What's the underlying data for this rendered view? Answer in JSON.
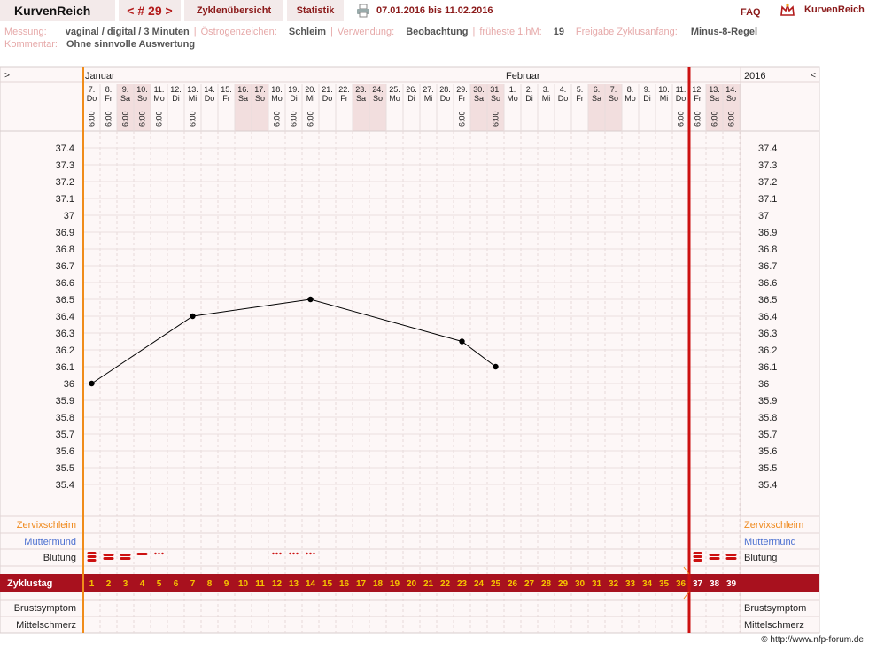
{
  "header": {
    "brand": "KurvenReich",
    "cycle_nav": "< # 29 >",
    "overview": "Zyklenübersicht",
    "stats": "Statistik",
    "date_range": "07.01.2016 bis 11.02.2016",
    "faq": "FAQ",
    "logo_text": "KurvenReich"
  },
  "info": {
    "messung_label": "Messung:",
    "messung_value": "vaginal / digital / 3 Minuten",
    "oestrogen_label": "Östrogenzeichen:",
    "oestrogen_value": "Schleim",
    "verwendung_label": "Verwendung:",
    "verwendung_value": "Beobachtung",
    "fruehe_label": "früheste 1.hM:",
    "fruehe_value": "19",
    "freigabe_label": "Freigabe Zyklusanfang:",
    "freigabe_value": "Minus-8-Regel",
    "kommentar_label": "Kommentar:",
    "kommentar_value": "Ohne sinnvolle Auswertung"
  },
  "nav": {
    "left_arrow": ">",
    "right_arrow": "<",
    "year": "2016"
  },
  "chart_data": {
    "type": "line",
    "months": [
      {
        "label": "Januar",
        "start_index": 0
      },
      {
        "label": "Februar",
        "start_index": 25
      }
    ],
    "days": [
      {
        "d": "7.",
        "w": "Do",
        "t": "6:00",
        "we": false
      },
      {
        "d": "8.",
        "w": "Fr",
        "t": "6:00",
        "we": false
      },
      {
        "d": "9.",
        "w": "Sa",
        "t": "6:00",
        "we": true
      },
      {
        "d": "10.",
        "w": "So",
        "t": "6:00",
        "we": true
      },
      {
        "d": "11.",
        "w": "Mo",
        "t": "6:00",
        "we": false
      },
      {
        "d": "12.",
        "w": "Di",
        "t": "",
        "we": false
      },
      {
        "d": "13.",
        "w": "Mi",
        "t": "6:00",
        "we": false
      },
      {
        "d": "14.",
        "w": "Do",
        "t": "",
        "we": false
      },
      {
        "d": "15.",
        "w": "Fr",
        "t": "",
        "we": false
      },
      {
        "d": "16.",
        "w": "Sa",
        "t": "",
        "we": true
      },
      {
        "d": "17.",
        "w": "So",
        "t": "",
        "we": true
      },
      {
        "d": "18.",
        "w": "Mo",
        "t": "6:00",
        "we": false
      },
      {
        "d": "19.",
        "w": "Di",
        "t": "6:00",
        "we": false
      },
      {
        "d": "20.",
        "w": "Mi",
        "t": "6:00",
        "we": false
      },
      {
        "d": "21.",
        "w": "Do",
        "t": "",
        "we": false
      },
      {
        "d": "22.",
        "w": "Fr",
        "t": "",
        "we": false
      },
      {
        "d": "23.",
        "w": "Sa",
        "t": "",
        "we": true
      },
      {
        "d": "24.",
        "w": "So",
        "t": "",
        "we": true
      },
      {
        "d": "25.",
        "w": "Mo",
        "t": "",
        "we": false
      },
      {
        "d": "26.",
        "w": "Di",
        "t": "",
        "we": false
      },
      {
        "d": "27.",
        "w": "Mi",
        "t": "",
        "we": false
      },
      {
        "d": "28.",
        "w": "Do",
        "t": "",
        "we": false
      },
      {
        "d": "29.",
        "w": "Fr",
        "t": "6:00",
        "we": false
      },
      {
        "d": "30.",
        "w": "Sa",
        "t": "",
        "we": true
      },
      {
        "d": "31.",
        "w": "So",
        "t": "6:00",
        "we": true
      },
      {
        "d": "1.",
        "w": "Mo",
        "t": "",
        "we": false
      },
      {
        "d": "2.",
        "w": "Di",
        "t": "",
        "we": false
      },
      {
        "d": "3.",
        "w": "Mi",
        "t": "",
        "we": false
      },
      {
        "d": "4.",
        "w": "Do",
        "t": "",
        "we": false
      },
      {
        "d": "5.",
        "w": "Fr",
        "t": "",
        "we": false
      },
      {
        "d": "6.",
        "w": "Sa",
        "t": "",
        "we": true
      },
      {
        "d": "7.",
        "w": "So",
        "t": "",
        "we": true
      },
      {
        "d": "8.",
        "w": "Mo",
        "t": "",
        "we": false
      },
      {
        "d": "9.",
        "w": "Di",
        "t": "",
        "we": false
      },
      {
        "d": "10.",
        "w": "Mi",
        "t": "",
        "we": false
      },
      {
        "d": "11.",
        "w": "Do",
        "t": "6:00",
        "we": false
      },
      {
        "d": "12.",
        "w": "Fr",
        "t": "6:00",
        "we": false
      },
      {
        "d": "13.",
        "w": "Sa",
        "t": "6:00",
        "we": true
      },
      {
        "d": "14.",
        "w": "So",
        "t": "6:00",
        "we": true
      }
    ],
    "y_ticks": [
      "37.4",
      "37.3",
      "37.2",
      "37.1",
      "37",
      "36.9",
      "36.8",
      "36.7",
      "36.6",
      "36.5",
      "36.4",
      "36.3",
      "36.2",
      "36.1",
      "36",
      "35.9",
      "35.8",
      "35.7",
      "35.6",
      "35.5",
      "35.4"
    ],
    "ylim": [
      35.4,
      37.4
    ],
    "series": [
      {
        "points": [
          [
            1,
            36.0
          ],
          [
            7,
            36.4
          ],
          [
            14,
            36.5
          ],
          [
            23,
            36.25
          ],
          [
            25,
            36.1
          ]
        ]
      }
    ],
    "cycle_day_label": "Zyklustag",
    "cycle_day_count": 39,
    "current_cycle_days": 36,
    "rows": {
      "zervix": "Zervixschleim",
      "muttermund": "Muttermund",
      "blutung": "Blutung",
      "brust": "Brustsymptom",
      "mittel": "Mittelschmerz"
    },
    "bleeding": [
      {
        "day": 1,
        "level": "stark"
      },
      {
        "day": 2,
        "level": "mittel"
      },
      {
        "day": 3,
        "level": "mittel"
      },
      {
        "day": 4,
        "level": "schwach"
      },
      {
        "day": 5,
        "level": "schmier"
      },
      {
        "day": 12,
        "level": "schmier"
      },
      {
        "day": 13,
        "level": "schmier"
      },
      {
        "day": 14,
        "level": "schmier"
      },
      {
        "day": 37,
        "level": "stark"
      },
      {
        "day": 38,
        "level": "mittel"
      },
      {
        "day": 39,
        "level": "mittel"
      }
    ],
    "colors": {
      "band": "#a8111e",
      "current_line": "#cc1111",
      "cycle_start_line": "#f08c1a",
      "zervix_label": "#ef8a1e",
      "muttermund_label": "#4a6fd0",
      "bleeding": "#cc1111",
      "weekend_bg": "#f2dede",
      "day_number": "#f5c400"
    }
  },
  "footer": {
    "copyright": "© http://www.nfp-forum.de"
  }
}
